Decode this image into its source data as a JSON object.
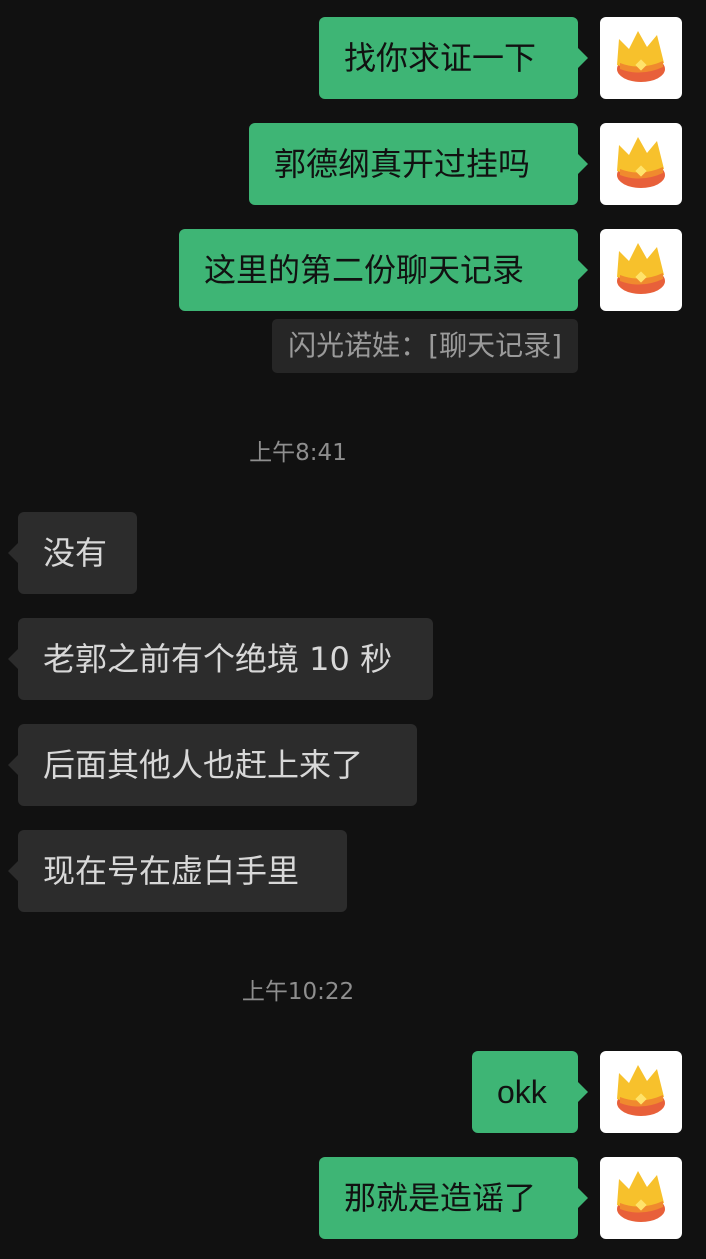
{
  "colors": {
    "background": "#111111",
    "outgoing_bubble": "#3eb575",
    "incoming_bubble": "#2c2c2c",
    "timestamp_text": "#8e8e8e"
  },
  "messages": {
    "out_1": {
      "text": "找你求证一下",
      "avatar": "crown-icon"
    },
    "out_2": {
      "text": "郭德纲真开过挂吗",
      "avatar": "crown-icon"
    },
    "out_3": {
      "text": "这里的第二份聊天记录",
      "avatar": "crown-icon"
    },
    "quote_1": {
      "text": "闪光诺娃：[聊天记录]"
    },
    "time_1": "上午8:41",
    "in_1": {
      "text": "没有"
    },
    "in_2": {
      "text": "老郭之前有个绝境 10 秒"
    },
    "in_3": {
      "text": "后面其他人也赶上来了"
    },
    "in_4": {
      "text": "现在号在虚白手里"
    },
    "time_2": "上午10:22",
    "out_4": {
      "text": "okk",
      "avatar": "crown-icon"
    },
    "out_5": {
      "text": "那就是造谣了",
      "avatar": "crown-icon"
    }
  }
}
